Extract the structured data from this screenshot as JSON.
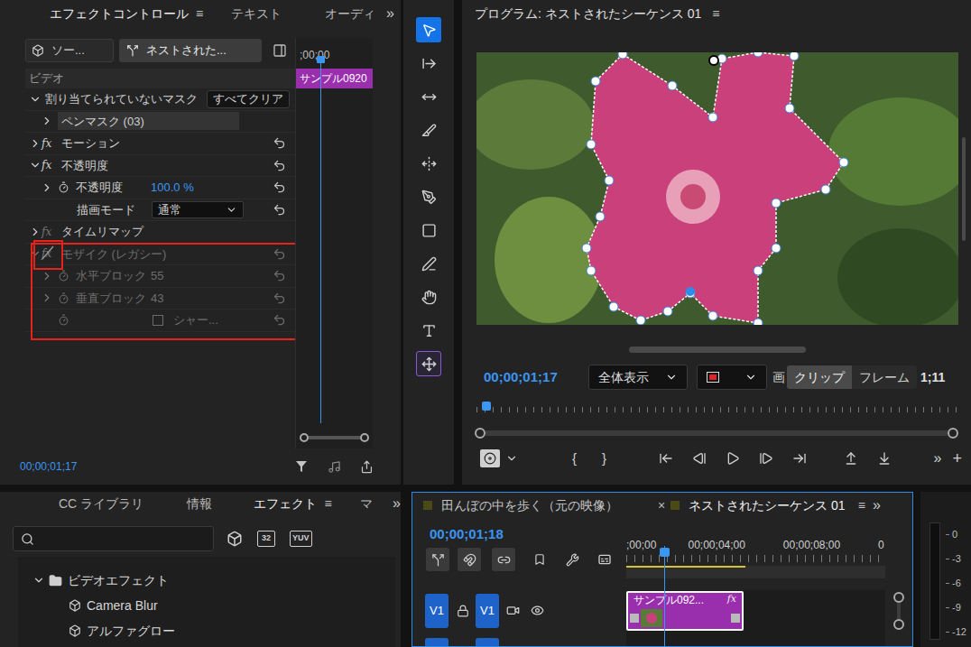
{
  "effect_controls": {
    "tabs": [
      {
        "label": "エフェクトコントロール",
        "selected": true
      },
      {
        "label": "テキスト",
        "selected": false
      },
      {
        "label": "オーディ",
        "selected": false
      }
    ],
    "tab_menu": "≡",
    "overflow": "»",
    "source_button": "ソー...",
    "clip_button": "ネストされた...",
    "ruler_start": ";00;00",
    "clip": "サンプル0920",
    "section": "ビデオ",
    "fx_label": "fx",
    "rows": [
      {
        "kind": "group",
        "label": "割り当てられていないマスク",
        "expanded": true,
        "button": "すべてクリア",
        "disabled": false,
        "outlined": false
      },
      {
        "kind": "mask",
        "label": "ペンマスク (03)",
        "expanded": false,
        "selected": true,
        "disabled": false,
        "outlined": false
      },
      {
        "kind": "effect",
        "label": "モーション",
        "expanded": false,
        "fx_disabled": false,
        "bypassed": false,
        "fx_boxed": false,
        "resettable": true,
        "disabled": false,
        "outlined": false
      },
      {
        "kind": "effect",
        "label": "不透明度",
        "expanded": true,
        "fx_disabled": false,
        "bypassed": false,
        "fx_boxed": false,
        "resettable": true,
        "disabled": false,
        "outlined": false
      },
      {
        "kind": "param",
        "label": "不透明度",
        "value": "100.0 %",
        "expanded": false,
        "resettable": true,
        "disabled": false,
        "outlined": false
      },
      {
        "kind": "dropdown",
        "label": "描画モード",
        "value": "通常",
        "resettable": true,
        "disabled": false,
        "outlined": false
      },
      {
        "kind": "effect",
        "label": "タイムリマップ",
        "expanded": false,
        "fx_disabled": true,
        "bypassed": false,
        "fx_boxed": false,
        "resettable": false,
        "disabled": false,
        "outlined": false
      },
      {
        "kind": "effect",
        "label": "モザイク (レガシー)",
        "expanded": true,
        "fx_disabled": false,
        "bypassed": true,
        "fx_boxed": true,
        "resettable": true,
        "disabled": true,
        "outlined": true
      },
      {
        "kind": "param",
        "label": "水平ブロック",
        "value": "55",
        "expanded": false,
        "resettable": true,
        "disabled": true,
        "outlined": true
      },
      {
        "kind": "param",
        "label": "垂直ブロック",
        "value": "43",
        "expanded": false,
        "resettable": true,
        "disabled": true,
        "outlined": true
      },
      {
        "kind": "checkbox",
        "label": "シャー...",
        "checked": false,
        "resettable": true,
        "disabled": true,
        "outlined": true
      }
    ],
    "timecode": "00;00;01;17"
  },
  "tools": [
    {
      "kind": "selection",
      "selected": true,
      "highlighted": false
    },
    {
      "kind": "track-select",
      "selected": false,
      "highlighted": false
    },
    {
      "kind": "ripple-edit",
      "selected": false,
      "highlighted": false
    },
    {
      "kind": "razor",
      "selected": false,
      "highlighted": false
    },
    {
      "kind": "slip",
      "selected": false,
      "highlighted": false
    },
    {
      "kind": "pen",
      "selected": false,
      "highlighted": false
    },
    {
      "kind": "rectangle",
      "selected": false,
      "highlighted": false
    },
    {
      "kind": "pen-line",
      "selected": false,
      "highlighted": false
    },
    {
      "kind": "hand",
      "selected": false,
      "highlighted": false
    },
    {
      "kind": "type",
      "selected": false,
      "highlighted": false
    },
    {
      "kind": "transform",
      "selected": false,
      "highlighted": true
    }
  ],
  "program": {
    "title": "プログラム: ネストされたシーケンス 01",
    "menu": "≡",
    "timecode": "00;00;01;17",
    "zoom": "全体表示",
    "clipped_label": "画",
    "toggle": [
      {
        "label": "クリップ",
        "selected": true
      },
      {
        "label": "フレーム",
        "selected": false
      }
    ],
    "duration": "1;11",
    "mark_in": "{",
    "mark_out": "}",
    "overflow": "»",
    "add": "+"
  },
  "effects_panel": {
    "tabs": [
      {
        "label": "CC ライブラリ",
        "selected": false
      },
      {
        "label": "情報",
        "selected": false
      },
      {
        "label": "エフェクト",
        "selected": true
      },
      {
        "label": "マ",
        "selected": false
      }
    ],
    "tab_menu": "≡",
    "overflow": "»",
    "badges": [
      "32",
      "YUV"
    ],
    "tree": [
      {
        "kind": "folder",
        "label": "ビデオエフェクト",
        "expanded": true
      },
      {
        "kind": "effect",
        "label": "Camera Blur",
        "expanded": false
      },
      {
        "kind": "effect",
        "label": "アルファグロー",
        "expanded": false
      }
    ]
  },
  "timeline": {
    "tabs": [
      {
        "label": "田んぼの中を歩く（元の映像）",
        "selected": false,
        "closable": false
      },
      {
        "label": "ネストされたシーケンス 01",
        "selected": true,
        "closable": true
      }
    ],
    "close": "×",
    "menu": "≡",
    "overflow": "»",
    "timecode": "00;00;01;18",
    "ruler": [
      ";00;00",
      "00;00;04;00",
      "00;00;08;00",
      "0"
    ],
    "tracks": [
      {
        "source": "V1",
        "target": "V1",
        "clip": {
          "label": "サンプル092...",
          "fx": "fx"
        }
      }
    ]
  },
  "meter": {
    "scale": [
      "0",
      "-3",
      "-6",
      "-9",
      "-12"
    ]
  }
}
